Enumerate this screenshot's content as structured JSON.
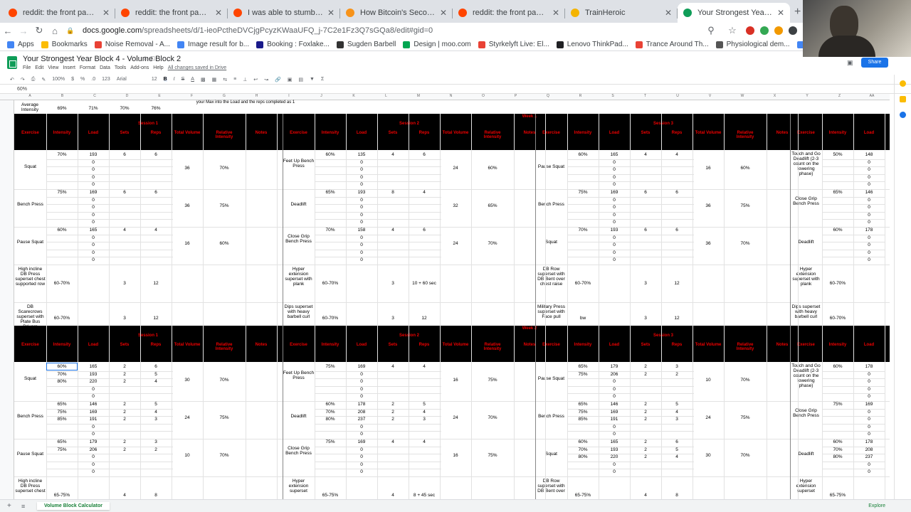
{
  "browser": {
    "tabs": [
      {
        "title": "reddit: the front page of the in",
        "color": "#ff4500",
        "active": false
      },
      {
        "title": "reddit: the front page of the in",
        "color": "#ff4500",
        "active": false
      },
      {
        "title": "I was able to stumble on to th",
        "color": "#ff4500",
        "active": false
      },
      {
        "title": "How Bitcoin's Second Halving",
        "color": "#f7931a",
        "active": false
      },
      {
        "title": "reddit: the front page of the in",
        "color": "#ff4500",
        "active": false
      },
      {
        "title": "TrainHeroic",
        "color": "#f4b400",
        "active": false
      },
      {
        "title": "Your Strongest Year Block 4 -",
        "color": "#0f9d58",
        "active": true
      }
    ],
    "new_tab": "+",
    "url_host": "docs.google.com",
    "url_path": "/spreadsheets/d/1-ieoPctheDVCjgPcyzKWaaUFQ_j-7C2e1Fz3Q7sGQa8/edit#gid=0",
    "bookmarks": [
      {
        "label": "Apps",
        "color": "#4285f4"
      },
      {
        "label": "Bookmarks",
        "color": "#fbbc05"
      },
      {
        "label": "Noise Removal - A...",
        "color": "#e94235"
      },
      {
        "label": "Image result for b...",
        "color": "#4285f4"
      },
      {
        "label": "Booking : Foxlake...",
        "color": "#1a1a8a"
      },
      {
        "label": "Sugden Barbell",
        "color": "#333333"
      },
      {
        "label": "Design | moo.com",
        "color": "#00a651"
      },
      {
        "label": "Styrkelyft Live: El...",
        "color": "#e94235"
      },
      {
        "label": "Lenovo ThinkPad...",
        "color": "#202124"
      },
      {
        "label": "Trance Around Th...",
        "color": "#e94235"
      },
      {
        "label": "Physiological dem...",
        "color": "#555555"
      },
      {
        "label": "centre for sport a...",
        "color": "#4285f4"
      }
    ]
  },
  "sheets": {
    "doc_title": "Your Strongest Year Block 4 - Volume Block 2",
    "menus": [
      "File",
      "Edit",
      "View",
      "Insert",
      "Format",
      "Data",
      "Tools",
      "Add-ons",
      "Help"
    ],
    "saved_text": "All changes saved in Drive",
    "share_label": "Share",
    "font_name": "Arial",
    "font_size": "12",
    "zoom": "100%",
    "formula_value": "60%",
    "sheet_tab": "Volume Block Calculator",
    "explore_label": "Explore"
  },
  "grid": {
    "column_letters": [
      "A",
      "B",
      "C",
      "D",
      "E",
      "F",
      "G",
      "H",
      "I",
      "J",
      "K",
      "L",
      "M",
      "N",
      "O",
      "P",
      "Q",
      "R",
      "S",
      "T",
      "U",
      "V",
      "W",
      "X",
      "Y",
      "Z",
      "AA"
    ],
    "avg_row": {
      "label": "Average Intensity",
      "values": [
        "69%",
        "71%",
        "70%",
        "76%"
      ],
      "note": "your Max into the Load and the reps completed as 1"
    },
    "headers": [
      "Exercise",
      "Intensity",
      "Load",
      "Sets",
      "Reps",
      "Total Volume",
      "Relative Intensity",
      "Notes"
    ],
    "week1": {
      "label": "Week 1",
      "sessions": [
        "Session 1",
        "Session 2",
        "Session 3"
      ],
      "rows": [
        {
          "s1": {
            "ex": "Squat",
            "int": [
              "70%"
            ],
            "load": [
              "193",
              "0",
              "0",
              "0",
              "0"
            ],
            "sets": "6",
            "reps": "6",
            "vol": "36",
            "rel": "70%"
          },
          "s2": {
            "ex": "Feet Up Bench Press",
            "int": [
              "60%"
            ],
            "load": [
              "135",
              "0",
              "0",
              "0",
              "0"
            ],
            "sets": "4",
            "reps": "6",
            "vol": "24",
            "rel": "60%"
          },
          "s3": {
            "ex": "Pause Squat",
            "int": [
              "60%"
            ],
            "load": [
              "165",
              "0",
              "0",
              "0",
              "0"
            ],
            "sets": "4",
            "reps": "4",
            "vol": "16",
            "rel": "60%"
          },
          "s4": {
            "ex": "Touch and Go Deadlift (2-3 count on the lowering phase)",
            "int": [
              "50%"
            ],
            "load": [
              "148",
              "0",
              "0",
              "0",
              "0"
            ]
          }
        },
        {
          "s1": {
            "ex": "Bench Press",
            "int": [
              "75%"
            ],
            "load": [
              "169",
              "0",
              "0",
              "0",
              "0"
            ],
            "sets": "6",
            "reps": "6",
            "vol": "36",
            "rel": "75%"
          },
          "s2": {
            "ex": "Deadlift",
            "int": [
              "65%"
            ],
            "load": [
              "193",
              "0",
              "0",
              "0",
              "0"
            ],
            "sets": "8",
            "reps": "4",
            "vol": "32",
            "rel": "65%"
          },
          "s3": {
            "ex": "Bench Press",
            "int": [
              "75%"
            ],
            "load": [
              "169",
              "0",
              "0",
              "0",
              "0"
            ],
            "sets": "6",
            "reps": "6",
            "vol": "36",
            "rel": "75%"
          },
          "s4": {
            "ex": "Close Grip Bench Press",
            "int": [
              "65%"
            ],
            "load": [
              "146",
              "0",
              "0",
              "0",
              "0"
            ]
          }
        },
        {
          "s1": {
            "ex": "Pause Squat",
            "int": [
              "60%"
            ],
            "load": [
              "165",
              "0",
              "0",
              "0",
              "0"
            ],
            "sets": "4",
            "reps": "4",
            "vol": "16",
            "rel": "60%"
          },
          "s2": {
            "ex": "Close Grip Bench Press",
            "int": [
              "70%"
            ],
            "load": [
              "158",
              "0",
              "0",
              "0",
              "0"
            ],
            "sets": "4",
            "reps": "6",
            "vol": "24",
            "rel": "70%"
          },
          "s3": {
            "ex": "Squat",
            "int": [
              "70%"
            ],
            "load": [
              "193",
              "0",
              "0",
              "0",
              "0"
            ],
            "sets": "6",
            "reps": "6",
            "vol": "36",
            "rel": "70%"
          },
          "s4": {
            "ex": "Deadlift",
            "int": [
              "60%"
            ],
            "load": [
              "178",
              "0",
              "0",
              "0",
              "0"
            ]
          }
        }
      ],
      "acc1": {
        "s1": {
          "ex": "High incline DB Press superset chest supported row",
          "int": "60-70%",
          "sets": "3",
          "reps": "12"
        },
        "s2": {
          "ex": "Hyper extension superset with plank",
          "int": "60-70%",
          "sets": "3",
          "reps": "10 + 60 sec"
        },
        "s3": {
          "ex": "DB Row superset with DB Bent over chest raise",
          "int": "60-70%",
          "sets": "3",
          "reps": "12"
        },
        "s4": {
          "ex": "Hyper extension superset with plank",
          "int": "60-70%"
        }
      },
      "acc2": {
        "s1": {
          "ex": "DB Scarecrows superset with Plate Bus Drivers",
          "int": "60-70%",
          "sets": "3",
          "reps": "12"
        },
        "s2": {
          "ex": "Dips superset with heavy barbell curl",
          "int": "60-70%",
          "sets": "3",
          "reps": "12"
        },
        "s3": {
          "ex": "Military Press superset with Face pull",
          "int": "bw",
          "sets": "3",
          "reps": "12"
        },
        "s4": {
          "ex": "Dips superset with heavy barbell curl",
          "int": "60-70%"
        }
      }
    },
    "week2": {
      "label": "Week 2",
      "sessions": [
        "Session 1",
        "Session 2",
        "Session 3"
      ],
      "rows": [
        {
          "s1": {
            "ex": "Squat",
            "int": [
              "60%",
              "70%",
              "80%"
            ],
            "load": [
              "165",
              "193",
              "220",
              "0",
              "0"
            ],
            "sets": [
              "2",
              "2",
              "2"
            ],
            "reps": [
              "6",
              "5",
              "4"
            ],
            "vol": "30",
            "rel": "70%"
          },
          "s2": {
            "ex": "Feet Up Bench Press",
            "int": [
              "75%"
            ],
            "load": [
              "169",
              "0",
              "0",
              "0",
              "0"
            ],
            "sets": [
              "4"
            ],
            "reps": [
              "4"
            ],
            "vol": "16",
            "rel": "75%"
          },
          "s3": {
            "ex": "Pause Squat",
            "int": [
              "65%",
              "75%"
            ],
            "load": [
              "179",
              "206",
              "0",
              "0",
              "0"
            ],
            "sets": [
              "2",
              "2"
            ],
            "reps": [
              "3",
              "2"
            ],
            "vol": "10",
            "rel": "70%"
          },
          "s4": {
            "ex": "Touch and Go Deadlift (2-3 count on the lowering phase)",
            "int": [
              "60%"
            ],
            "load": [
              "178",
              "0",
              "0",
              "0",
              "0"
            ]
          }
        },
        {
          "s1": {
            "ex": "Bench Press",
            "int": [
              "65%",
              "75%",
              "85%"
            ],
            "load": [
              "146",
              "169",
              "191",
              "0",
              "0"
            ],
            "sets": [
              "2",
              "2",
              "2"
            ],
            "reps": [
              "5",
              "4",
              "3"
            ],
            "vol": "24",
            "rel": "75%"
          },
          "s2": {
            "ex": "Deadlift",
            "int": [
              "60%",
              "70%",
              "80%"
            ],
            "load": [
              "178",
              "208",
              "237",
              "0",
              "0"
            ],
            "sets": [
              "2",
              "2",
              "2"
            ],
            "reps": [
              "5",
              "4",
              "3"
            ],
            "vol": "24",
            "rel": "70%"
          },
          "s3": {
            "ex": "Bench Press",
            "int": [
              "65%",
              "75%",
              "85%"
            ],
            "load": [
              "146",
              "169",
              "191",
              "0",
              "0"
            ],
            "sets": [
              "2",
              "2",
              "2"
            ],
            "reps": [
              "5",
              "4",
              "3"
            ],
            "vol": "24",
            "rel": "75%"
          },
          "s4": {
            "ex": "Close Grip Bench Press",
            "int": [
              "75%"
            ],
            "load": [
              "169",
              "0",
              "0",
              "0",
              "0"
            ]
          }
        },
        {
          "s1": {
            "ex": "Pause Squat",
            "int": [
              "65%",
              "75%"
            ],
            "load": [
              "179",
              "206",
              "0",
              "0",
              "0"
            ],
            "sets": [
              "2",
              "2"
            ],
            "reps": [
              "3",
              "2"
            ],
            "vol": "10",
            "rel": "70%"
          },
          "s2": {
            "ex": "Close Grip Bench Press",
            "int": [
              "75%"
            ],
            "load": [
              "169",
              "0",
              "0",
              "0",
              "0"
            ],
            "sets": [
              "4"
            ],
            "reps": [
              "4"
            ],
            "vol": "16",
            "rel": "75%"
          },
          "s3": {
            "ex": "Squat",
            "int": [
              "60%",
              "70%",
              "80%"
            ],
            "load": [
              "165",
              "193",
              "220",
              "0",
              "0"
            ],
            "sets": [
              "2",
              "2",
              "2"
            ],
            "reps": [
              "6",
              "5",
              "4"
            ],
            "vol": "30",
            "rel": "70%"
          },
          "s4": {
            "ex": "Deadlift",
            "int": [
              "60%",
              "70%",
              "80%"
            ],
            "load": [
              "178",
              "208",
              "237",
              "0",
              "0"
            ]
          }
        }
      ],
      "acc1": {
        "s1": {
          "ex": "High incline DB Press superset chest",
          "int": "65-75%",
          "sets": "4",
          "reps": "8"
        },
        "s2": {
          "ex": "Hyper extension superset",
          "int": "65-75%",
          "sets": "4",
          "reps": "8 + 45 sec"
        },
        "s3": {
          "ex": "DB Row superset with DB Bent over",
          "int": "65-75%",
          "sets": "4",
          "reps": "8"
        },
        "s4": {
          "ex": "Hyper extension superset",
          "int": "65-75%"
        }
      }
    }
  }
}
